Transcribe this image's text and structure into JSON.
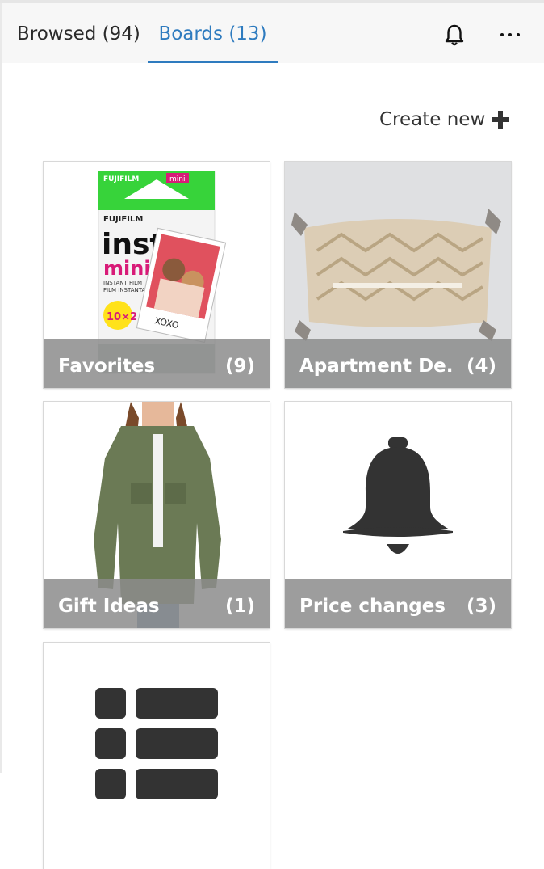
{
  "tabs": [
    {
      "label": "Browsed (94)"
    },
    {
      "label": "Boards (13)"
    }
  ],
  "icons": {
    "notifications": "bell-icon",
    "more": "more-horizontal-icon",
    "create": "plus-icon"
  },
  "accent_color": "#2e7bbf",
  "create_new": {
    "label": "Create new"
  },
  "boards": [
    {
      "title": "Favorites",
      "count": "(9)"
    },
    {
      "title": "Apartment De...",
      "count": "(4)"
    },
    {
      "title": "Gift Ideas",
      "count": "(1)"
    },
    {
      "title": "Price changes",
      "count": "(3)"
    },
    {
      "title": "",
      "count": ""
    }
  ],
  "product_text": {
    "brand": "FUJIFILM",
    "badge": "mini",
    "product_name": "instax",
    "product_sub": "mini",
    "subtitle1": "INSTANT FILM",
    "subtitle2": "FILM INSTANTANÉ",
    "pack": "10×2",
    "caption": "XOXO"
  }
}
